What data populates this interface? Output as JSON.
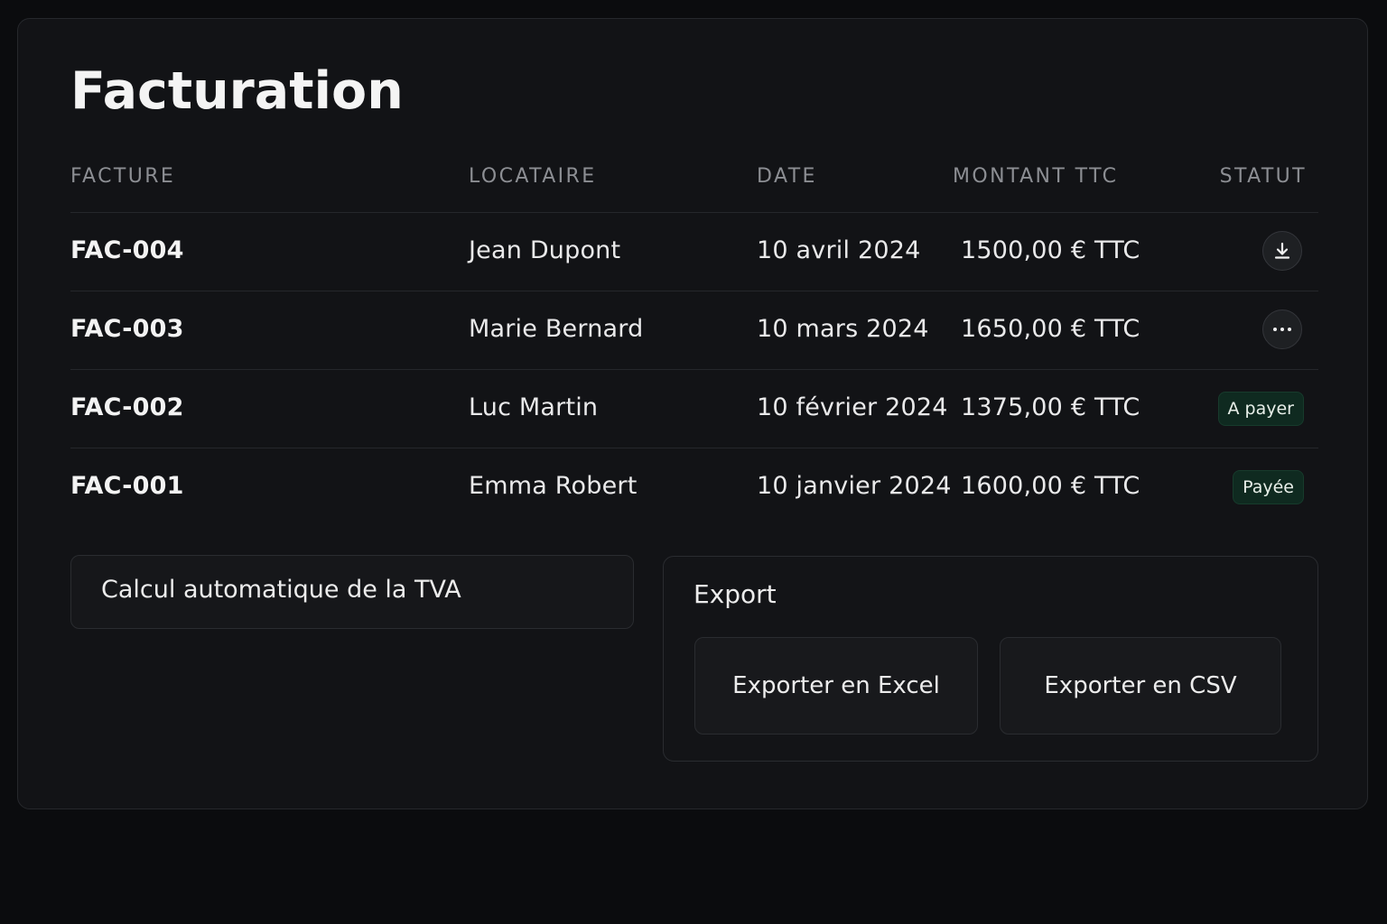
{
  "page": {
    "title": "Facturation"
  },
  "table": {
    "headers": {
      "invoice": "FACTURE",
      "tenant": "LOCATAIRE",
      "date": "DATE",
      "amount": "MONTANT TTC",
      "status": "STATUT"
    },
    "rows": [
      {
        "invoice": "FAC-004",
        "tenant": "Jean Dupont",
        "date": "10 avril 2024",
        "amount": "1500,00 € TTC",
        "status_type": "icon",
        "status_icon": "download-icon"
      },
      {
        "invoice": "FAC-003",
        "tenant": "Marie Bernard",
        "date": "10 mars 2024",
        "amount": "1650,00 € TTC",
        "status_type": "icon",
        "status_icon": "more-icon"
      },
      {
        "invoice": "FAC-002",
        "tenant": "Luc Martin",
        "date": "10 février 2024",
        "amount": "1375,00 € TTC",
        "status_type": "badge",
        "status_label": "A payer"
      },
      {
        "invoice": "FAC-001",
        "tenant": "Emma Robert",
        "date": "10 janvier 2024",
        "amount": "1600,00 € TTC",
        "status_type": "badge",
        "status_label": "Payée"
      }
    ]
  },
  "tva": {
    "label": "Calcul automatique de la TVA"
  },
  "export": {
    "title": "Export",
    "excel_label": "Exporter en Excel",
    "csv_label": "Exporter en CSV"
  },
  "colors": {
    "background": "#0b0c0e",
    "panel": "#121316",
    "badge_bg": "#0f2a20",
    "text": "#ececec",
    "muted": "#8c8e93"
  }
}
